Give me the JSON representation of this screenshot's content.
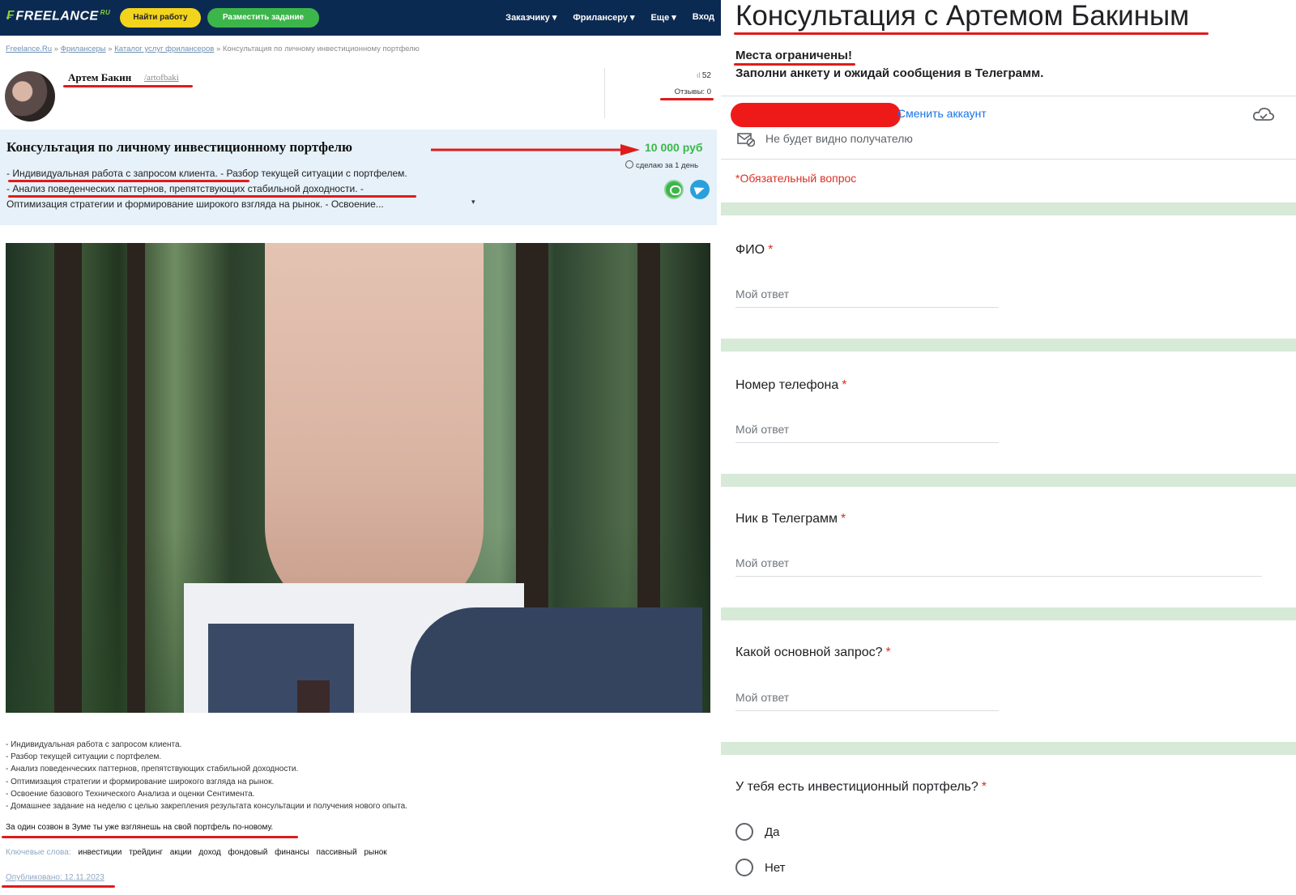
{
  "left": {
    "header": {
      "logo": "FREELANCE",
      "logo_suffix": "RU",
      "find_work": "Найти работу",
      "post_task": "Разместить задание",
      "nav": [
        "Заказчику ▾",
        "Фрилансеру ▾",
        "Еще ▾",
        "Вход"
      ]
    },
    "breadcrumb": {
      "items": [
        "Freelance.Ru",
        "Фрилансеры",
        "Каталог услуг фрилансеров"
      ],
      "current": "Консультация по личному инвестиционному портфелю"
    },
    "author": {
      "name": "Артем Бакин",
      "login": "/artofbaki",
      "rating": "52",
      "reviews": "Отзывы: 0"
    },
    "service": {
      "title": "Консультация по личному инвестиционному портфелю",
      "price": "10 000 руб",
      "deadline": "сделаю за 1 день",
      "desc_lines": [
        "- Индивидуальная работа с запросом клиента. - Разбор текущей ситуации с портфелем.",
        "- Анализ поведенческих паттернов, препятствующих стабильной доходности. -",
        "Оптимизация стратегии и формирование широкого взгляда на рынок. - Освоение..."
      ]
    },
    "bullets": [
      "- Индивидуальная работа с запросом клиента.",
      "- Разбор текущей ситуации с портфелем.",
      "- Анализ поведенческих паттернов, препятствующих стабильной доходности.",
      "- Оптимизация стратегии и формирование широкого взгляда на рынок.",
      "- Освоение базового Технического Анализа и оценки Сентимента.",
      "- Домашнее задание на неделю с целью закрепления результата консультации и получения нового опыта."
    ],
    "zoom_note": "За один созвон в Зуме ты уже взглянешь на свой портфель по-новому.",
    "keywords_label": "Ключевые слова:",
    "keywords": [
      "инвестиции",
      "трейдинг",
      "акции",
      "доход",
      "фондовый",
      "финансы",
      "пассивный",
      "рынок"
    ],
    "published": "Опубликовано: 12.11.2023"
  },
  "right": {
    "title": "Консультация с Артемом Бакиным",
    "subtitle_1": "Места ограничены!",
    "subtitle_2": "Заполни анкету и ожидай сообщения в Телеграмм.",
    "switch_account": "Сменить аккаунт",
    "not_visible": "Не будет видно получателю",
    "required_note": "*Обязательный вопрос",
    "placeholder": "Мой ответ",
    "questions": [
      {
        "label": "ФИО"
      },
      {
        "label": "Номер телефона"
      },
      {
        "label": "Ник в Телеграмм"
      },
      {
        "label": "Какой основной запрос?"
      },
      {
        "label": "У тебя есть инвестиционный портфель?"
      }
    ],
    "options": [
      "Да",
      "Нет"
    ]
  },
  "colors": {
    "nav_bg": "#0b2a52",
    "accent_green": "#3cb64a",
    "accent_yellow": "#f2d41d",
    "card_bg": "#e6f1fa",
    "annotation_red": "#e01b1b",
    "form_link": "#1a73e8",
    "form_required": "#d93025",
    "form_separator": "#d7e9d7"
  }
}
